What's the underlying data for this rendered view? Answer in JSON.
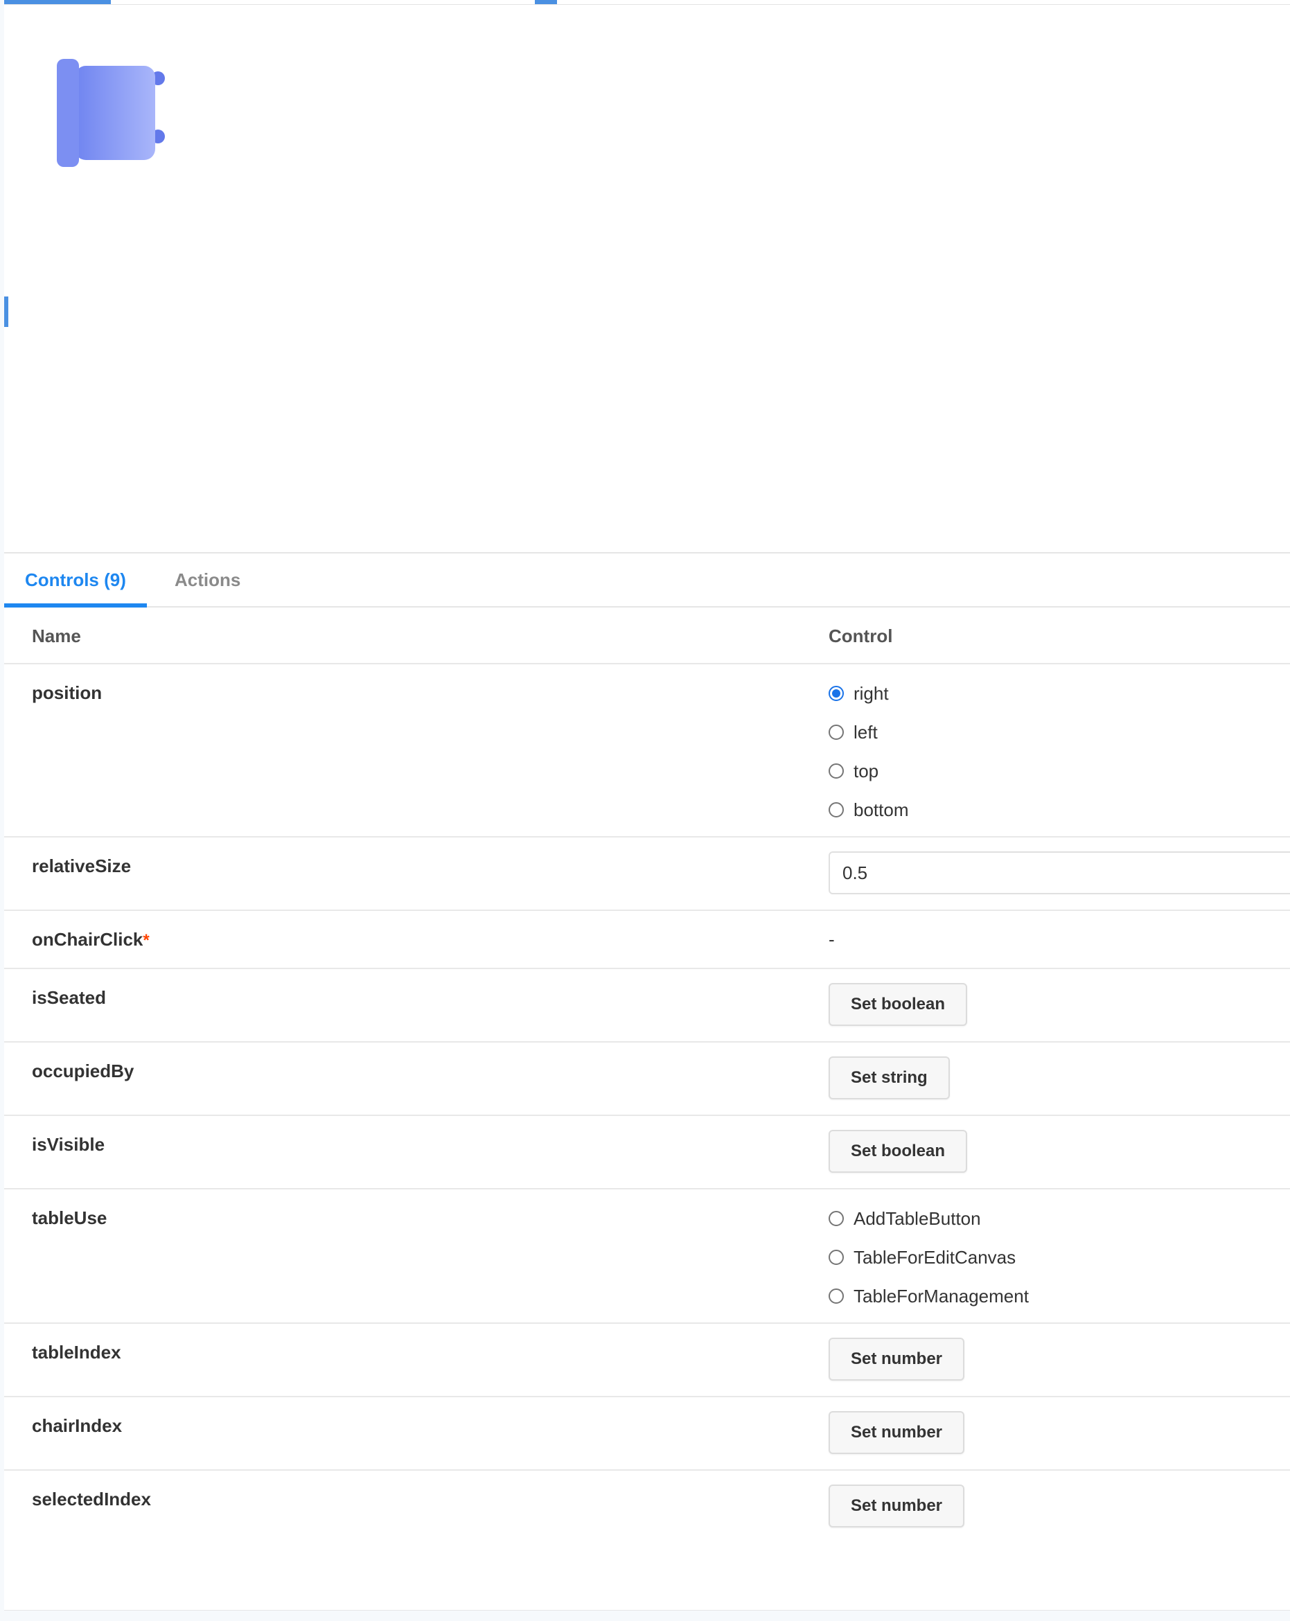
{
  "colors": {
    "accent": "#1e87f0",
    "chair_gradient_start": "#6f84f0",
    "chair_gradient_end": "#a9b6fa"
  },
  "preview": {
    "icon": "chair-icon"
  },
  "tabs": [
    {
      "label": "Controls (9)",
      "active": true
    },
    {
      "label": "Actions",
      "active": false
    }
  ],
  "table": {
    "headers": {
      "name": "Name",
      "control": "Control"
    },
    "rows": [
      {
        "name": "position",
        "type": "radio",
        "options": [
          "right",
          "left",
          "top",
          "bottom"
        ],
        "selected": "right"
      },
      {
        "name": "relativeSize",
        "type": "text",
        "value": "0.5"
      },
      {
        "name": "onChairClick",
        "required_mark": "*",
        "type": "none",
        "value": "-"
      },
      {
        "name": "isSeated",
        "type": "button",
        "button": "Set boolean"
      },
      {
        "name": "occupiedBy",
        "type": "button",
        "button": "Set string"
      },
      {
        "name": "isVisible",
        "type": "button",
        "button": "Set boolean"
      },
      {
        "name": "tableUse",
        "type": "radio",
        "options": [
          "AddTableButton",
          "TableForEditCanvas",
          "TableForManagement"
        ],
        "selected": null
      },
      {
        "name": "tableIndex",
        "type": "button",
        "button": "Set number"
      },
      {
        "name": "chairIndex",
        "type": "button",
        "button": "Set number"
      },
      {
        "name": "selectedIndex",
        "type": "button",
        "button": "Set number"
      }
    ]
  }
}
